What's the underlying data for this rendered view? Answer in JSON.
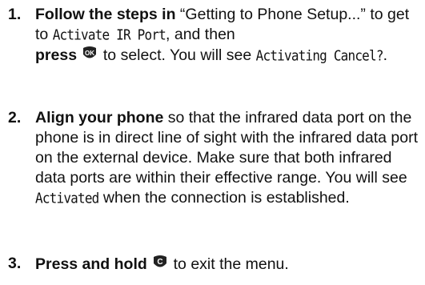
{
  "steps": [
    {
      "number": "1.",
      "lead": "Follow the steps in",
      "text_a": " “Getting to Phone Setup...” to get to ",
      "menu_item": "Activate IR Port",
      "text_b": ", and then ",
      "action": "press",
      "key_label": "OK",
      "text_c": " to select. You will see ",
      "display_text": "Activating Cancel?",
      "text_d": "."
    },
    {
      "number": "2.",
      "lead": "Align your phone",
      "text_a": " so that the infrared data port on the phone is in direct line of sight with the infrared data port on the external device. Make sure that both infrared data ports are within their effective range. You will see ",
      "display_text": "Activated",
      "text_b": " when the connection is established."
    },
    {
      "number": "3.",
      "lead": "Press and hold",
      "key_label": "C",
      "text_a": " to exit the menu."
    }
  ],
  "icons": {
    "ok_key": "ok-key-icon",
    "clear_key": "clear-key-icon"
  },
  "colors": {
    "text": "#111111",
    "key_fill": "#222222",
    "key_text": "#ffffff"
  }
}
